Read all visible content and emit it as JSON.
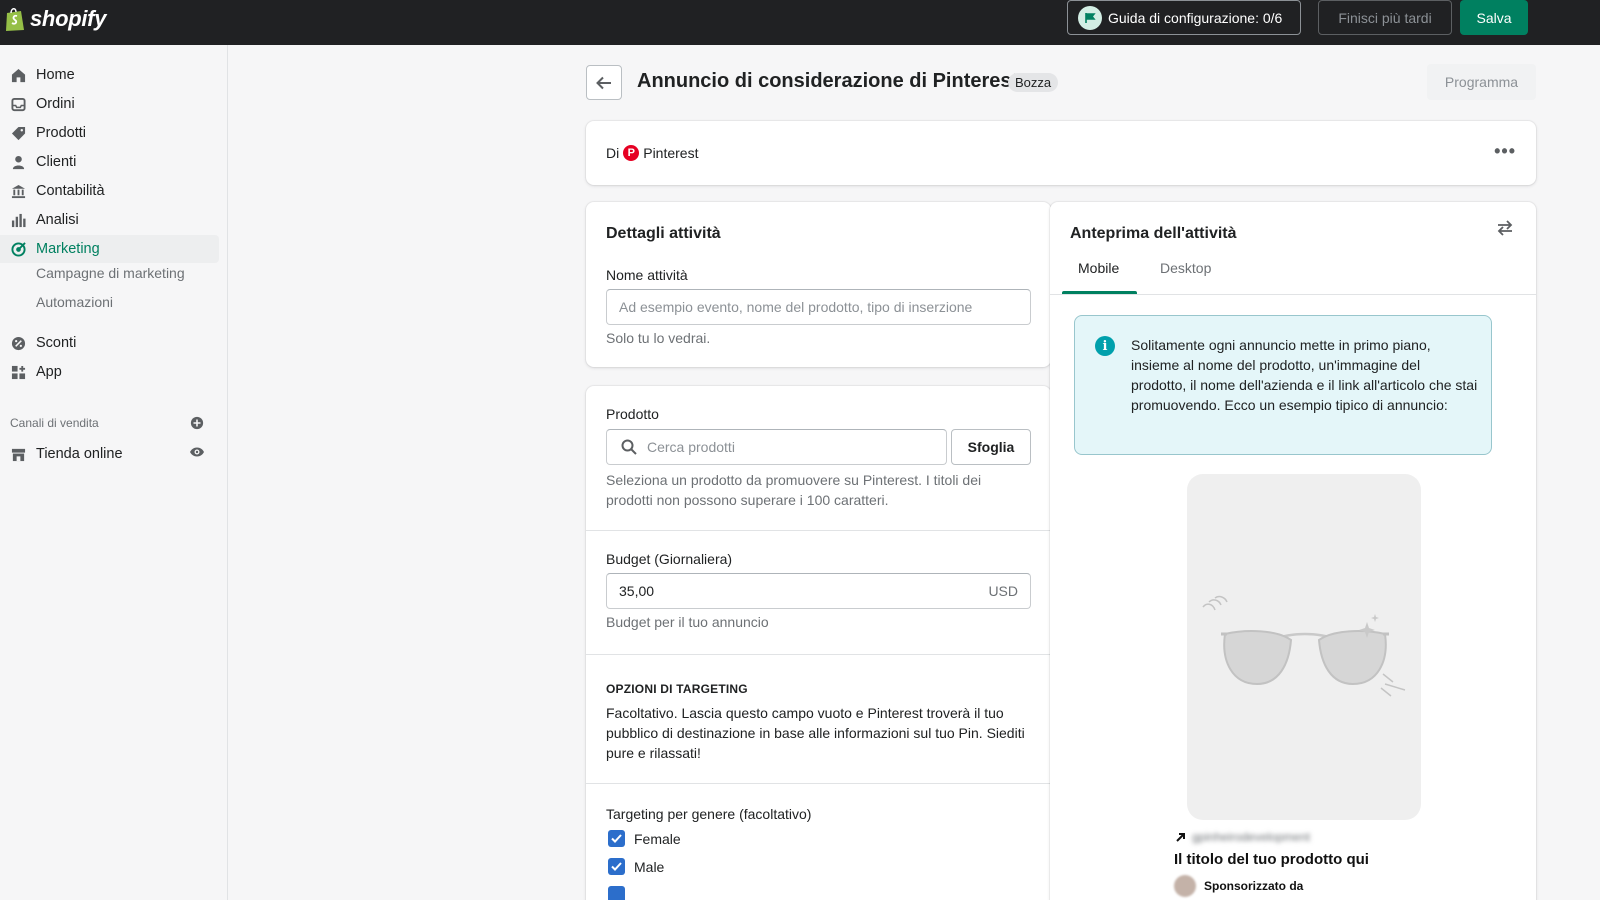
{
  "topbar": {
    "brand": "shopify",
    "setup_guide": "Guida di configurazione: 0/6",
    "finish_later": "Finisci più tardi",
    "save": "Salva"
  },
  "sidebar": {
    "items": [
      {
        "label": "Home",
        "icon": "home-icon"
      },
      {
        "label": "Ordini",
        "icon": "orders-icon"
      },
      {
        "label": "Prodotti",
        "icon": "tag-icon"
      },
      {
        "label": "Clienti",
        "icon": "person-icon"
      },
      {
        "label": "Contabilità",
        "icon": "bank-icon"
      },
      {
        "label": "Analisi",
        "icon": "bar-chart-icon"
      },
      {
        "label": "Marketing",
        "icon": "target-icon",
        "active": true
      },
      {
        "label": "Sconti",
        "icon": "discount-icon"
      },
      {
        "label": "App",
        "icon": "apps-icon"
      }
    ],
    "marketing_sub": [
      "Campagne di marketing",
      "Automazioni"
    ],
    "sales_channels_label": "Canali di vendita",
    "online_store": "Tienda online"
  },
  "page": {
    "title": "Annuncio di considerazione di Pinterest",
    "status_badge": "Bozza",
    "schedule": "Programma"
  },
  "by_card": {
    "prefix": "Di",
    "provider": "Pinterest"
  },
  "details": {
    "heading": "Dettagli attività",
    "name_label": "Nome attività",
    "name_placeholder": "Ad esempio evento, nome del prodotto, tipo di inserzione",
    "name_help": "Solo tu lo vedrai."
  },
  "form": {
    "product_label": "Prodotto",
    "product_placeholder": "Cerca prodotti",
    "browse": "Sfoglia",
    "product_help": "Seleziona un prodotto da promuovere su Pinterest. I titoli dei prodotti non possono superare i 100 caratteri.",
    "budget_label": "Budget (Giornaliera)",
    "budget_value": "35,00",
    "budget_currency": "USD",
    "budget_help": "Budget per il tuo annuncio",
    "targeting_heading": "OPZIONI DI TARGETING",
    "targeting_text": "Facoltativo. Lascia questo campo vuoto e Pinterest troverà il tuo pubblico di destinazione in base alle informazioni sul tuo Pin. Siediti pure e rilassati!",
    "gender_label": "Targeting per genere (facoltativo)",
    "genders": [
      {
        "label": "Female",
        "checked": true
      },
      {
        "label": "Male",
        "checked": true
      }
    ]
  },
  "preview": {
    "heading": "Anteprima dell'attività",
    "tabs": [
      "Mobile",
      "Desktop"
    ],
    "active_tab": "Mobile",
    "info": "Solitamente ogni annuncio mette in primo piano, insieme al nome del prodotto, un'immagine del prodotto, il nome dell'azienda e il link all'articolo che stai promuovendo. Ecco un esempio tipico di annuncio:",
    "pin_domain": "gpinheirodevelopment",
    "pin_title": "Il titolo del tuo prodotto qui",
    "pin_sponsored": "Sponsorizzato da"
  },
  "colors": {
    "accent": "#008060",
    "topbar": "#202123",
    "checkbox": "#2c6ecb",
    "pinterest": "#e60023",
    "info_bg": "#e4f6f9"
  }
}
